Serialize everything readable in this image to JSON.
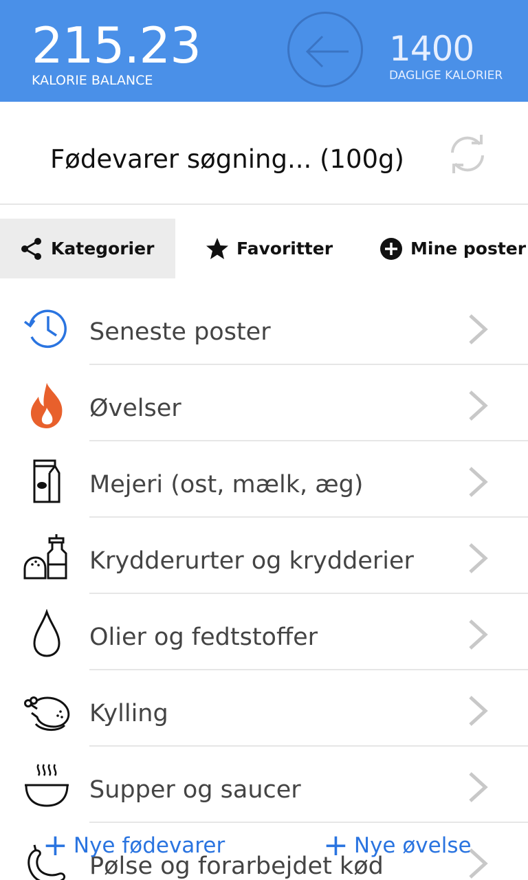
{
  "header": {
    "balance_value": "215.23",
    "balance_label": "KALORIE BALANCE",
    "daily_value": "1400",
    "daily_label": "DAGLIGE KALORIER",
    "back_icon": "arrow-left-circle-icon",
    "background_color": "#4a90e8"
  },
  "search": {
    "text": "Fødevarer søgning... (100g)",
    "refresh_icon": "refresh-icon"
  },
  "tabs": [
    {
      "label": "Kategorier",
      "icon": "share-icon",
      "active": true
    },
    {
      "label": "Favoritter",
      "icon": "star-icon",
      "active": false
    },
    {
      "label": "Mine poster",
      "icon": "plus-circle-icon",
      "active": false
    }
  ],
  "categories": [
    {
      "label": "Seneste poster",
      "icon": "history-clock-icon"
    },
    {
      "label": "Øvelser",
      "icon": "flame-icon"
    },
    {
      "label": "Mejeri (ost, mælk, æg)",
      "icon": "milk-carton-icon"
    },
    {
      "label": "Krydderurter og krydderier",
      "icon": "salt-pepper-icon"
    },
    {
      "label": "Olier og fedtstoffer",
      "icon": "oil-drop-icon"
    },
    {
      "label": "Kylling",
      "icon": "chicken-icon"
    },
    {
      "label": "Supper og saucer",
      "icon": "soup-bowl-icon"
    },
    {
      "label": "Pølse og forarbejdet kød",
      "icon": "sausage-icon"
    }
  ],
  "actions": {
    "new_food": "Nye fødevarer",
    "new_exercise": "Nye øvelse",
    "accent_color": "#2a74e0"
  }
}
